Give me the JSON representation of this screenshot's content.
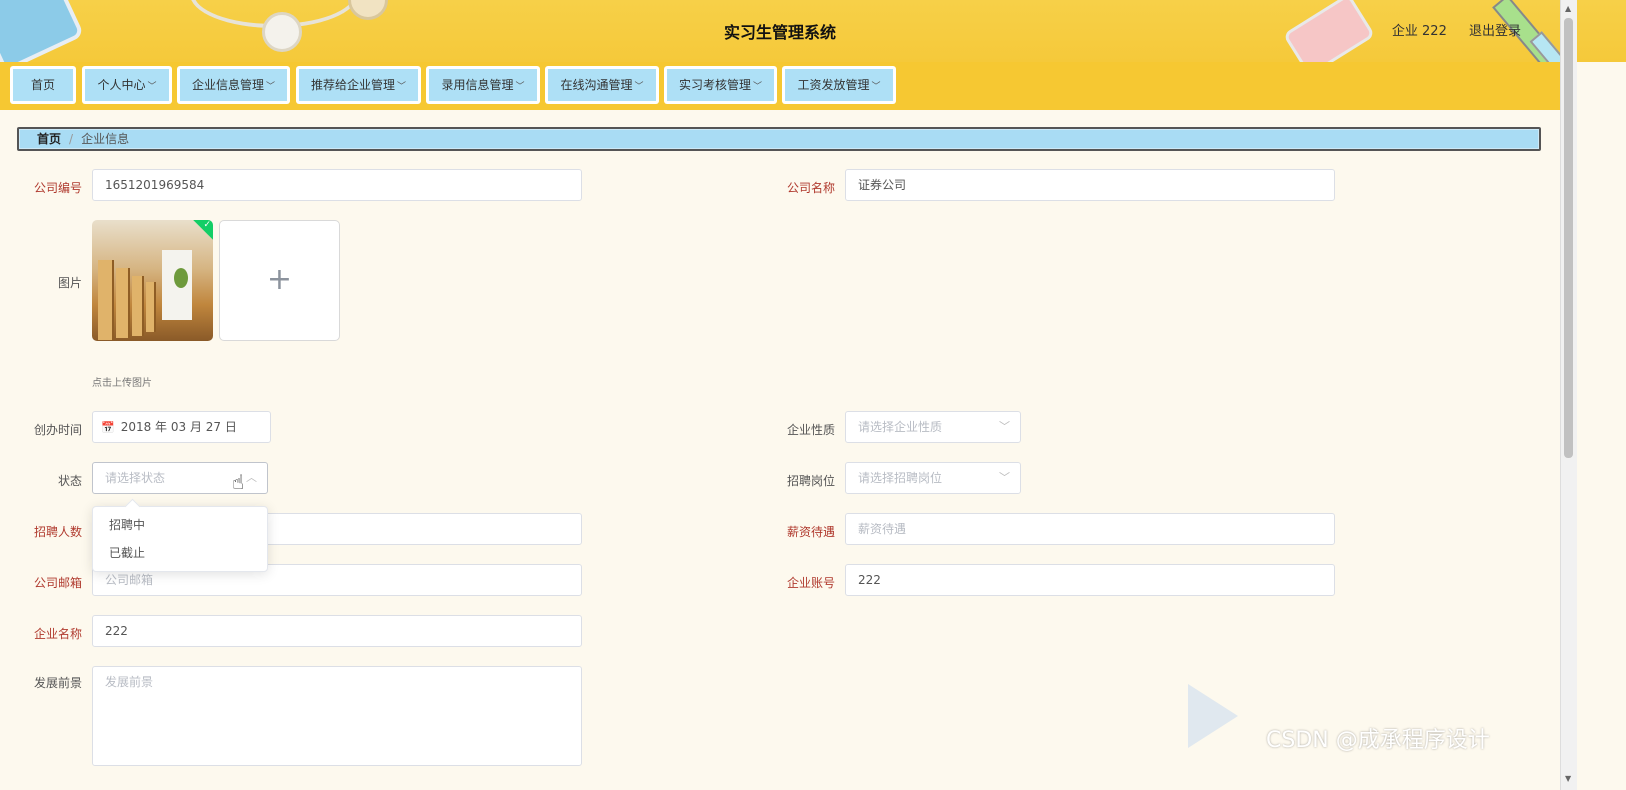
{
  "header": {
    "system_title": "实习生管理系统",
    "user_label": "企业 222",
    "logout_label": "退出登录"
  },
  "nav": {
    "items": [
      {
        "label": "首页",
        "has_dropdown": false
      },
      {
        "label": "个人中心",
        "has_dropdown": true
      },
      {
        "label": "企业信息管理",
        "has_dropdown": true
      },
      {
        "label": "推荐给企业管理",
        "has_dropdown": true
      },
      {
        "label": "录用信息管理",
        "has_dropdown": true
      },
      {
        "label": "在线沟通管理",
        "has_dropdown": true
      },
      {
        "label": "实习考核管理",
        "has_dropdown": true
      },
      {
        "label": "工资发放管理",
        "has_dropdown": true
      }
    ],
    "chevron": "﹀"
  },
  "breadcrumb": {
    "home": "首页",
    "separator": "/",
    "current": "企业信息"
  },
  "form": {
    "company_no": {
      "label": "公司编号",
      "value": "1651201969584"
    },
    "company_name": {
      "label": "公司名称",
      "value": "证券公司"
    },
    "image": {
      "label": "图片",
      "upload_tip": "点击上传图片",
      "plus": "+"
    },
    "founded": {
      "label": "创办时间",
      "value": "2018 年 03 月 27 日"
    },
    "nature": {
      "label": "企业性质",
      "placeholder": "请选择企业性质"
    },
    "status": {
      "label": "状态",
      "placeholder": "请选择状态",
      "options": [
        "招聘中",
        "已截止"
      ]
    },
    "position": {
      "label": "招聘岗位",
      "placeholder": "请选择招聘岗位"
    },
    "headcount": {
      "label": "招聘人数"
    },
    "salary": {
      "label": "薪资待遇",
      "placeholder": "薪资待遇"
    },
    "email": {
      "label": "公司邮箱",
      "placeholder": "公司邮箱"
    },
    "account": {
      "label": "企业账号",
      "value": "222"
    },
    "enterprise_name": {
      "label": "企业名称",
      "value": "222"
    },
    "prospects": {
      "label": "发展前景",
      "placeholder": "发展前景"
    }
  },
  "watermark": "CSDN @成承程序设计"
}
